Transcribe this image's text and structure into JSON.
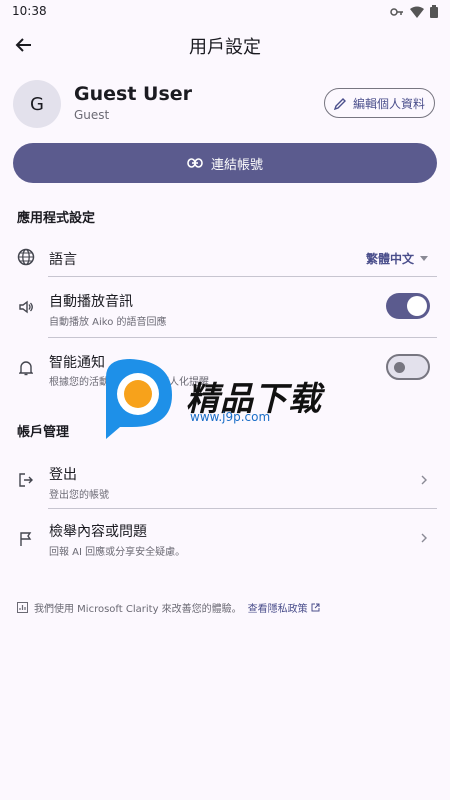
{
  "status": {
    "time": "10:38"
  },
  "appbar": {
    "title": "用戶設定"
  },
  "profile": {
    "avatar_initial": "G",
    "name": "Guest User",
    "role": "Guest",
    "edit_label": "編輯個人資料"
  },
  "connect": {
    "label": "連結帳號"
  },
  "app_settings": {
    "section_title": "應用程式設定",
    "language": {
      "label": "語言",
      "value": "繁體中文"
    },
    "autoplay": {
      "title": "自動播放音訊",
      "subtitle": "自動播放 Aiko 的語音回應",
      "enabled": true
    },
    "notify": {
      "title": "智能通知",
      "subtitle": "根據您的活動提供通知與個人化提醒",
      "enabled": false
    }
  },
  "account": {
    "section_title": "帳戶管理",
    "logout": {
      "title": "登出",
      "subtitle": "登出您的帳號"
    },
    "report": {
      "title": "檢舉內容或問題",
      "subtitle": "回報 AI 回應或分享安全疑慮。"
    }
  },
  "footer": {
    "text": "我們使用 Microsoft Clarity 來改善您的體驗。",
    "link": "查看隱私政策"
  },
  "watermark": {
    "text": "精品下载",
    "url": "www.j9p.com"
  },
  "colors": {
    "primary": "#5B5B8E",
    "background": "#FCF8FE",
    "accent_text": "#4B4F8C"
  }
}
